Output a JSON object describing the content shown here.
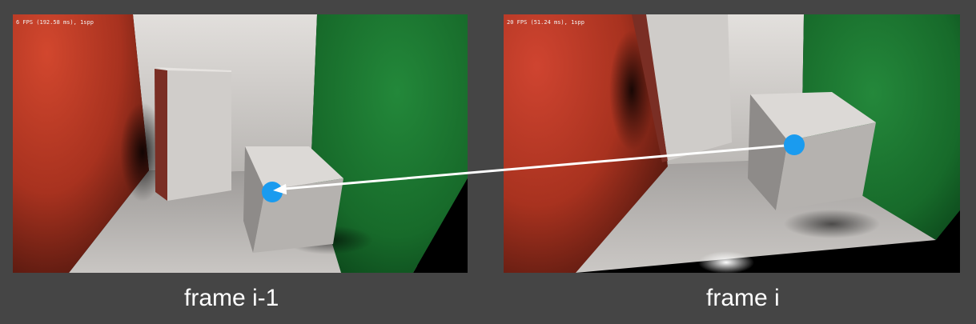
{
  "frames": [
    {
      "fps_text": "6 FPS (192.58 ms), 1spp",
      "caption": "frame i-1"
    },
    {
      "fps_text": "20 FPS (51.24 ms), 1spp",
      "caption": "frame i"
    }
  ],
  "colors": {
    "background": "#454545",
    "marker": "#1a9bef",
    "arrow": "#ffffff",
    "red_wall": "#c8402a",
    "green_wall": "#1f7a32",
    "back_wall": "#c9c6c4",
    "floor": "#a8a5a3"
  }
}
